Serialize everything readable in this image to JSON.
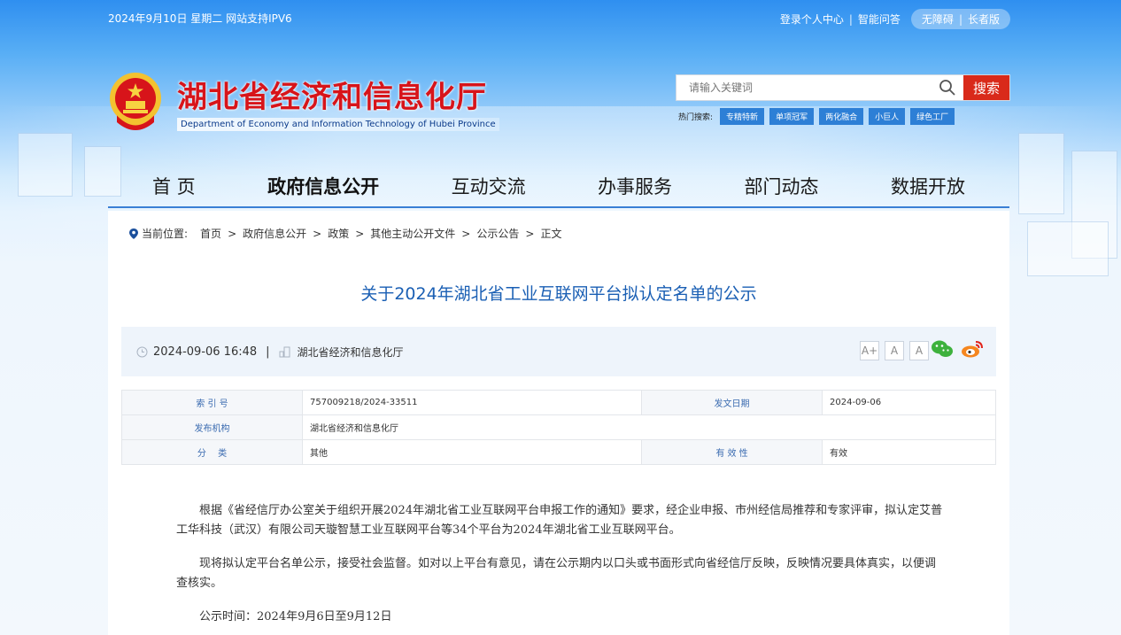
{
  "topbar": {
    "date_text": "2024年9月10日 星期二  网站支持IPV6",
    "links": [
      "登录个人中心",
      "智能问答"
    ],
    "pill": [
      "无障碍",
      "长者版"
    ]
  },
  "brand": {
    "title_cn": "湖北省经济和信息化厅",
    "title_en": "Department of Economy and Information Technology of Hubei Province"
  },
  "search": {
    "placeholder": "请输入关键词",
    "button_label": "搜索",
    "hot_label": "热门搜索:",
    "hot_tags": [
      "专精特新",
      "单项冠军",
      "两化融合",
      "小巨人",
      "绿色工厂"
    ]
  },
  "nav": [
    "首 页",
    "政府信息公开",
    "互动交流",
    "办事服务",
    "部门动态",
    "数据开放"
  ],
  "breadcrumb": {
    "label": "当前位置:",
    "items": [
      "首页",
      "政府信息公开",
      "政策",
      "其他主动公开文件",
      "公示公告",
      "正文"
    ],
    "separator": ">"
  },
  "document": {
    "title": "关于2024年湖北省工业互联网平台拟认定名单的公示",
    "datetime": "2024-09-06 16:48",
    "publisher": "湖北省经济和信息化厅",
    "font_size_buttons": [
      "A+",
      "A",
      "A"
    ],
    "info": {
      "index_label": "索 引 号",
      "index_value": "757009218/2024-33511",
      "date_label": "发文日期",
      "date_value": "2024-09-06",
      "issuer_label": "发布机构",
      "issuer_value": "湖北省经济和信息化厅",
      "category_label": "分　 类",
      "category_value": "其他",
      "validity_label": "有 效 性",
      "validity_value": "有效"
    },
    "paragraphs": [
      "根据《省经信厅办公室关于组织开展2024年湖北省工业互联网平台申报工作的通知》要求，经企业申报、市州经信局推荐和专家评审，拟认定艾普工华科技（武汉）有限公司天璇智慧工业互联网平台等34个平台为2024年湖北省工业互联网平台。",
      "现将拟认定平台名单公示，接受社会监督。如对以上平台有意见，请在公示期内以口头或书面形式向省经信厅反映，反映情况要具体真实，以便调查核实。",
      "公示时间：2024年9月6日至9月12日"
    ]
  },
  "colors": {
    "brand_red": "#d7141a",
    "link_blue": "#1a5fb4",
    "tag_blue": "#2d7fd6",
    "search_red": "#d92a1a"
  },
  "icons": [
    "search-icon",
    "location-pin-icon",
    "clock-icon",
    "publisher-icon",
    "wechat-icon",
    "weibo-icon",
    "emblem-icon"
  ]
}
